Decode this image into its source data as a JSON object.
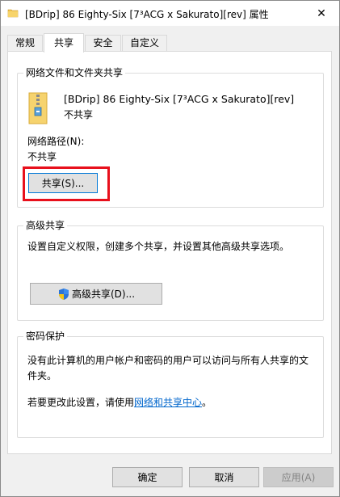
{
  "window": {
    "title": "[BDrip] 86 Eighty-Six [7³ACG x Sakurato][rev] 属性",
    "close_glyph": "✕"
  },
  "tabs": [
    {
      "label": "常规",
      "active": false
    },
    {
      "label": "共享",
      "active": true
    },
    {
      "label": "安全",
      "active": false
    },
    {
      "label": "自定义",
      "active": false
    }
  ],
  "network_sharing": {
    "group_title": "网络文件和文件夹共享",
    "folder_name": "[BDrip] 86 Eighty-Six [7³ACG x Sakurato][rev]",
    "folder_status": "不共享",
    "path_label": "网络路径(N):",
    "path_value": "不共享",
    "share_button": "共享(S)..."
  },
  "advanced_sharing": {
    "group_title": "高级共享",
    "description": "设置自定义权限，创建多个共享，并设置其他高级共享选项。",
    "button": "高级共享(D)..."
  },
  "password_protection": {
    "group_title": "密码保护",
    "description_line1": "没有此计算机的用户帐户和密码的用户可以访问与所有人共享的文",
    "description_line2": "件夹。",
    "change_prefix": "若要更改此设置，请使用",
    "change_link": "网络和共享中心",
    "change_suffix": "。"
  },
  "footer": {
    "ok": "确定",
    "cancel": "取消",
    "apply": "应用(A)"
  },
  "colors": {
    "highlight_box": "#e8101c",
    "link": "#0066cc",
    "focus_border": "#0078d7"
  },
  "icons": {
    "title": "folder-icon",
    "folder": "folder-zip-icon",
    "shield": "uac-shield-icon"
  }
}
